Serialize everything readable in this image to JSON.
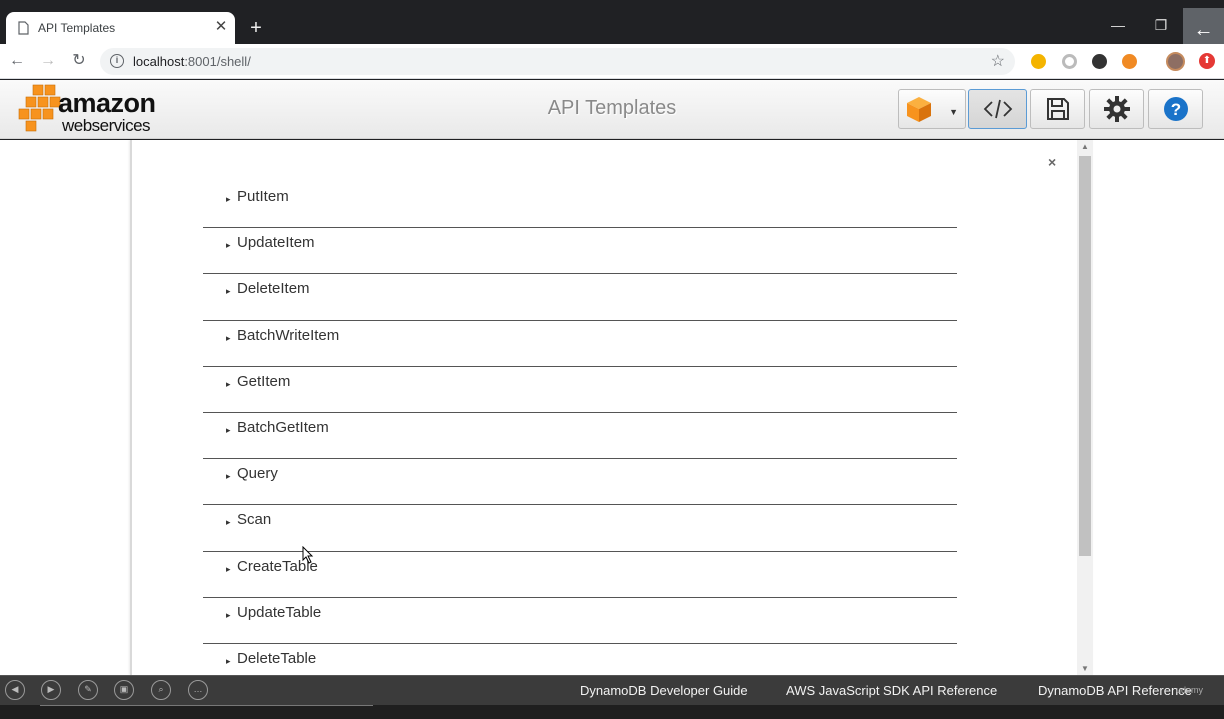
{
  "browser": {
    "tab_title": "API Templates",
    "tab_close": "✕",
    "new_tab": "+",
    "url_host": "localhost",
    "url_rest": ":8001/shell/",
    "window_controls": {
      "minimize": "—",
      "restore": "❐",
      "close": "✕"
    }
  },
  "header": {
    "logo_line1": "amazon",
    "logo_line2": "webservices",
    "title": "API Templates",
    "buttons": [
      "dynamodb-cube",
      "code",
      "save",
      "settings",
      "help"
    ]
  },
  "modal": {
    "close_label": "×",
    "items": [
      {
        "label": "PutItem"
      },
      {
        "label": "UpdateItem"
      },
      {
        "label": "DeleteItem"
      },
      {
        "label": "BatchWriteItem"
      },
      {
        "label": "GetItem"
      },
      {
        "label": "BatchGetItem"
      },
      {
        "label": "Query"
      },
      {
        "label": "Scan"
      },
      {
        "label": "CreateTable"
      },
      {
        "label": "UpdateTable"
      },
      {
        "label": "DeleteTable"
      }
    ]
  },
  "footer": {
    "links": [
      "DynamoDB Developer Guide",
      "AWS JavaScript SDK API Reference",
      "DynamoDB API Reference"
    ],
    "watermark": "udemy"
  },
  "colors": {
    "aws_orange": "#f7931e",
    "help_blue": "#1a73c9",
    "active_border": "#5b9bd5"
  }
}
